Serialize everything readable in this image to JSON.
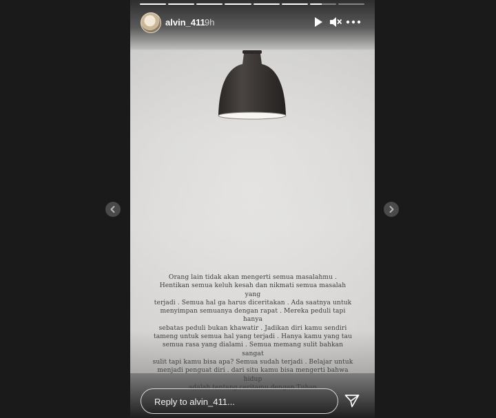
{
  "story": {
    "username": "alvin_411",
    "time": "9h",
    "progress_segments": 8,
    "progress_current_fraction": 0.5,
    "quote_lines": [
      "Orang lain tidak akan mengerti semua masalahmu .",
      "Hentikan semua keluh kesah dan nikmati semua masalah yang",
      "terjadi . Semua hal ga harus diceritakan . Ada saatnya untuk",
      "menyimpan semuanya dengan rapat . Mereka peduli tapi hanya",
      "sebatas peduli bukan khawatir . Jadikan diri kamu sendiri",
      "tameng untuk semua hal yang terjadi . Hanya kamu yang tau",
      "semua rasa yang dialami . Semua memang sulit bahkan sangat",
      "sulit tapi kamu bisa apa? Semua sudah terjadi . Belajar untuk",
      "menjadi penguat diri . dari situ kamu bisa mengerti bahwa hidup",
      "adalah tentang ceritamu dengan Tuhan"
    ]
  },
  "reply": {
    "placeholder": "Reply to alvin_411..."
  },
  "icons": {
    "play": "play-icon",
    "mute": "speaker-muted-icon",
    "more": "more-horizontal-icon",
    "send": "paper-plane-icon",
    "prev": "chevron-left-icon",
    "next": "chevron-right-icon"
  },
  "colors": {
    "page_background": "#1a1a1a",
    "nav_button": "#4a4a4a",
    "text_on_story": "#ffffff"
  }
}
